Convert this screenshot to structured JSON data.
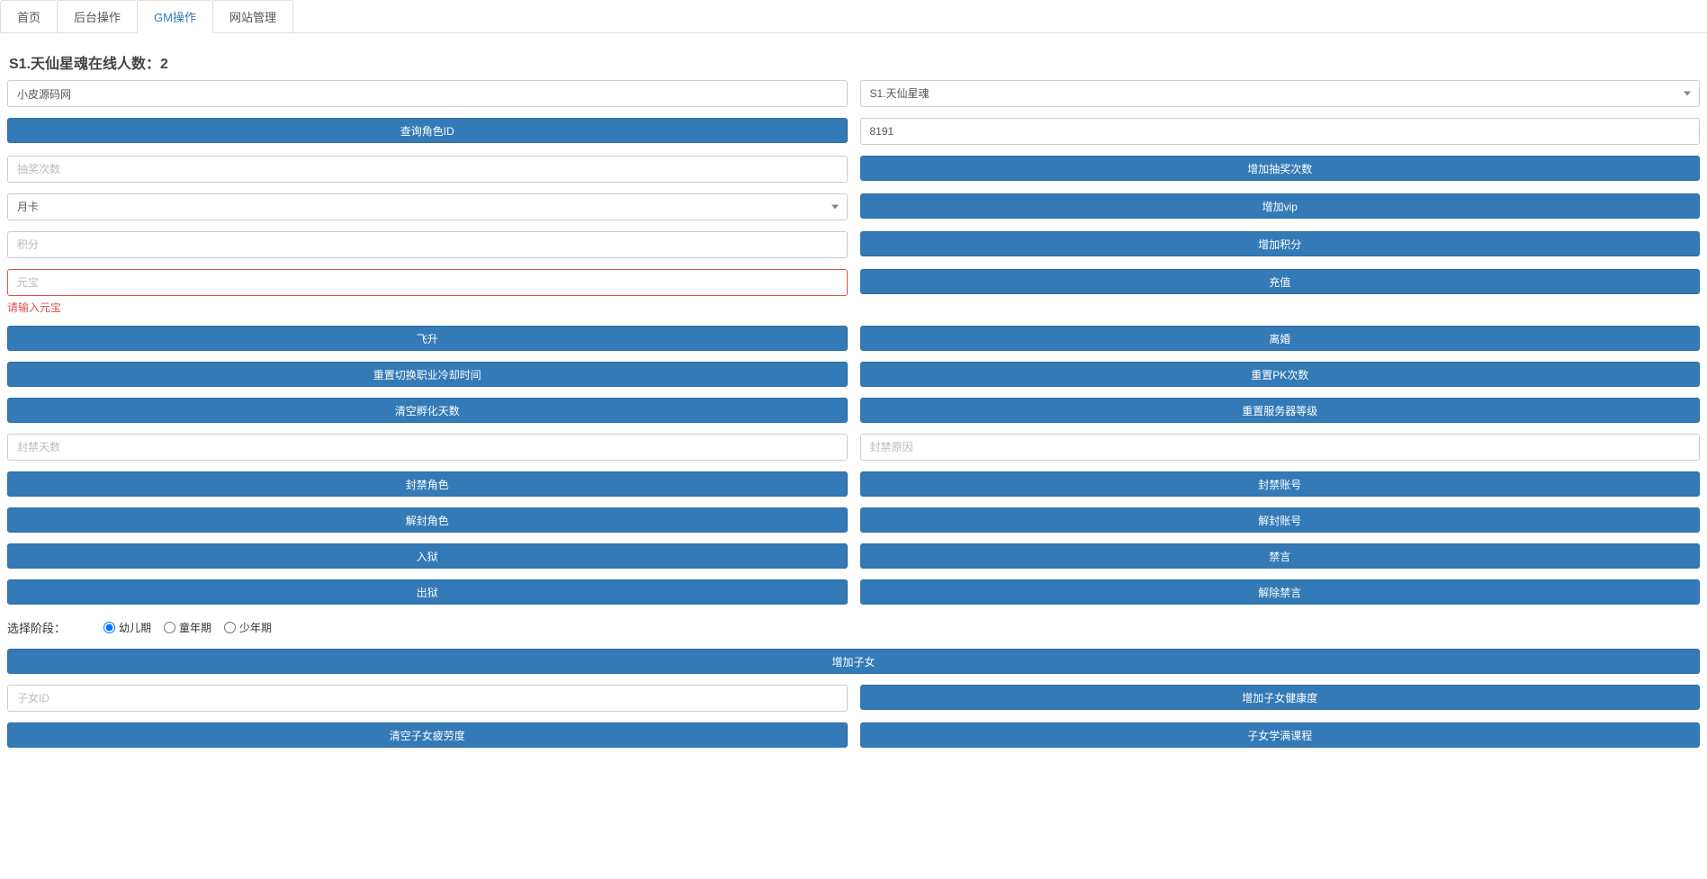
{
  "tabs": {
    "items": [
      {
        "label": "首页"
      },
      {
        "label": "后台操作"
      },
      {
        "label": "GM操作"
      },
      {
        "label": "网站管理"
      }
    ],
    "activeIndex": 2
  },
  "header": {
    "title_prefix": "S1.天仙星魂在线人数：",
    "online_count": "2"
  },
  "row_account": {
    "account_value": "小皮源码网",
    "server_selected": "S1.天仙星魂"
  },
  "row_role": {
    "query_role_btn": "查询角色ID",
    "role_id_value": "8191"
  },
  "row_draw": {
    "draw_placeholder": "抽奖次数",
    "add_draw_btn": "增加抽奖次数"
  },
  "row_vip": {
    "vip_selected": "月卡",
    "add_vip_btn": "增加vip"
  },
  "row_points": {
    "points_placeholder": "积分",
    "add_points_btn": "增加积分"
  },
  "row_yuanbao": {
    "yuanbao_placeholder": "元宝",
    "yuanbao_error": "请输入元宝",
    "recharge_btn": "充值"
  },
  "row_misc1": {
    "left": "飞升",
    "right": "离婚"
  },
  "row_misc2": {
    "left": "重置切换职业冷却时间",
    "right": "重置PK次数"
  },
  "row_misc3": {
    "left": "清空孵化天数",
    "right": "重置服务器等级"
  },
  "row_ban_inputs": {
    "ban_days_placeholder": "封禁天数",
    "ban_reason_placeholder": "封禁原因"
  },
  "row_ban1": {
    "left": "封禁角色",
    "right": "封禁账号"
  },
  "row_ban2": {
    "left": "解封角色",
    "right": "解封账号"
  },
  "row_ban3": {
    "left": "入狱",
    "right": "禁言"
  },
  "row_ban4": {
    "left": "出狱",
    "right": "解除禁言"
  },
  "stage": {
    "label": "选择阶段：",
    "options": [
      "幼儿期",
      "童年期",
      "少年期"
    ],
    "selectedIndex": 0
  },
  "row_child_add": {
    "btn": "增加子女"
  },
  "row_child2": {
    "child_id_placeholder": "子女ID",
    "add_health_btn": "增加子女健康度"
  },
  "row_child3": {
    "left": "清空子女疲劳度",
    "right": "子女学满课程"
  }
}
